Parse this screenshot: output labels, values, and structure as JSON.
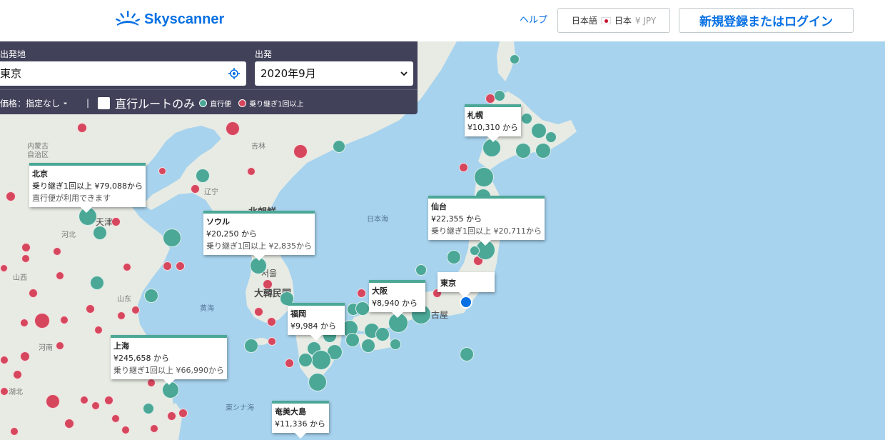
{
  "header": {
    "brand": "Skyscanner",
    "help": "ヘルプ",
    "locale": {
      "language": "日本語",
      "country": "日本",
      "currency": "¥ JPY"
    },
    "login": "新規登録またはログイン"
  },
  "search": {
    "origin_label": "出発地",
    "origin_value": "東京",
    "depart_label": "出発",
    "depart_value": "2020年9月",
    "price_filter": "価格：指定なし",
    "separator": "|",
    "direct_only": "直行ルートのみ",
    "legend_direct": "直行便",
    "legend_indirect": "乗り継ぎ1回以上"
  },
  "map_labels": {
    "inner_mongolia": "内蒙古\n自治区",
    "jilin": "吉林",
    "liaoning": "辽宁",
    "hebei": "河北",
    "shanxi": "山西",
    "shandong": "山东",
    "henan": "河南",
    "hubei": "湖北",
    "tianjin": "天津",
    "north_korea": "北朝鮮",
    "south_korea": "大韓民国",
    "seoul": "서울",
    "sea_of_japan": "日本海",
    "yellow_sea": "黄海",
    "east_china_sea": "東シナ海",
    "nagoya": "古屋",
    "tokyo_map": "東"
  },
  "callouts": [
    {
      "name": "北京",
      "line1": "乗り継ぎ1回以上 ¥79,088から",
      "line2": "直行便が利用できます"
    },
    {
      "name": "ソウル",
      "line1": "¥20,250 から",
      "line2": "乗り継ぎ1回以上 ¥2,835から"
    },
    {
      "name": "札幌",
      "line1": "¥10,310 から",
      "line2": ""
    },
    {
      "name": "仙台",
      "line1": "¥22,355 から",
      "line2": "乗り継ぎ1回以上 ¥20,711から"
    },
    {
      "name": "大阪",
      "line1": "¥8,940 から",
      "line2": ""
    },
    {
      "name": "東京",
      "line1": "",
      "line2": ""
    },
    {
      "name": "福岡",
      "line1": "¥9,984 から",
      "line2": ""
    },
    {
      "name": "上海",
      "line1": "¥245,658 から",
      "line2": "乗り継ぎ1回以上 ¥66,990から"
    },
    {
      "name": "奄美大島",
      "line1": "¥11,336 から",
      "line2": ""
    }
  ],
  "colors": {
    "direct": "#4ba897",
    "indirect": "#d6475e",
    "accent": "#0770e3",
    "panel": "#41415a"
  }
}
